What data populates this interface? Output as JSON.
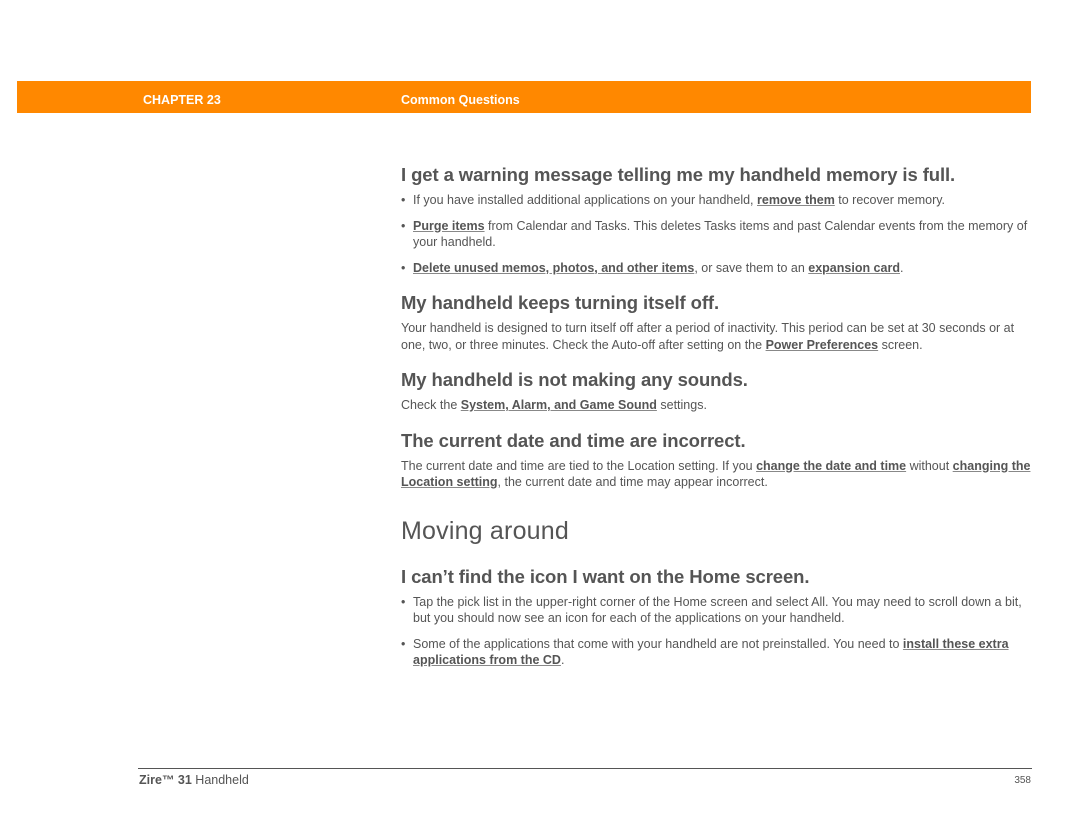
{
  "header": {
    "chapter_label": "CHAPTER 23",
    "chapter_title": "Common Questions",
    "bar_color": "#ff8800"
  },
  "sections": {
    "memory_full": {
      "title": "I get a warning message telling me my handheld memory is full.",
      "items": [
        {
          "pre": "If you have installed additional applications on your handheld, ",
          "link": "remove them",
          "post": " to recover memory."
        },
        {
          "pre": "",
          "link": "Purge items",
          "post": " from Calendar and Tasks. This deletes Tasks items and past Calendar events from the memory of your handheld."
        },
        {
          "pre": "",
          "link": "Delete unused memos, photos, and other items",
          "mid": ", or save them to an ",
          "link2": "expansion card",
          "post": "."
        }
      ]
    },
    "turning_off": {
      "title": "My handheld keeps turning itself off.",
      "pre": "Your handheld is designed to turn itself off after a period of inactivity. This period can be set at 30 seconds or at one, two, or three minutes. Check the Auto-off after setting on the ",
      "link": "Power Preferences",
      "post": " screen."
    },
    "no_sounds": {
      "title": "My handheld is not making any sounds.",
      "pre": "Check the ",
      "link": "System, Alarm, and Game Sound",
      "post": " settings."
    },
    "date_time": {
      "title": "The current date and time are incorrect.",
      "pre": "The current date and time are tied to the Location setting. If you ",
      "link": "change the date and time",
      "mid": " without ",
      "link2": "changing the Location setting",
      "post": ", the current date and time may appear incorrect."
    },
    "moving_around": {
      "title": "Moving around"
    },
    "cant_find_icon": {
      "title": "I can’t find the icon I want on the Home screen.",
      "items": [
        {
          "text": "Tap the pick list in the upper-right corner of the Home screen and select All. You may need to scroll down a bit, but you should now see an icon for each of the applications on your handheld."
        },
        {
          "pre": "Some of the applications that come with your handheld are not preinstalled. You need to ",
          "link": "install these extra applications from the CD",
          "post": "."
        }
      ]
    }
  },
  "footer": {
    "product_bold": "Zire™ 31",
    "product_rest": " Handheld",
    "page_number": "358"
  },
  "bullet_glyph": "•"
}
